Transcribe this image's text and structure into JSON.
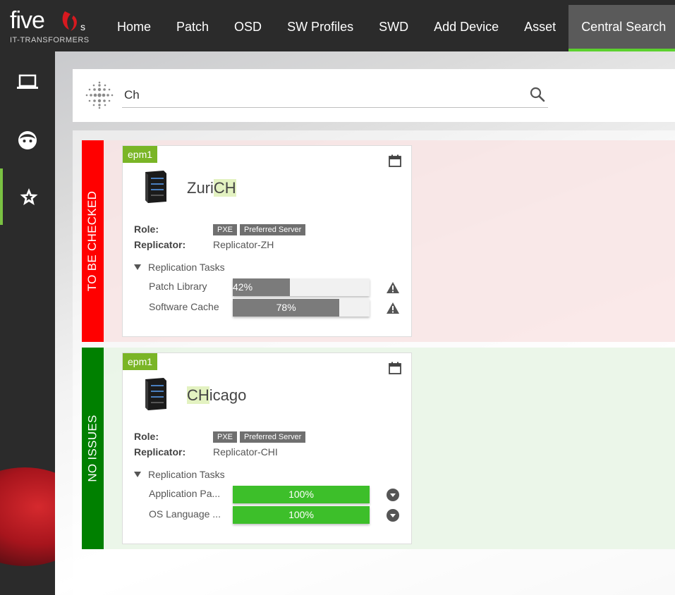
{
  "logo": {
    "word": "five",
    "suffix": "s",
    "subtitle": "IT-TRANSFORMERS"
  },
  "nav": {
    "items": [
      {
        "label": "Home"
      },
      {
        "label": "Patch"
      },
      {
        "label": "OSD"
      },
      {
        "label": "SW Profiles"
      },
      {
        "label": "SWD"
      },
      {
        "label": "Add Device"
      },
      {
        "label": "Asset"
      },
      {
        "label": "Central Search",
        "active": true
      }
    ]
  },
  "sidebar": {
    "items": [
      {
        "icon": "laptop-icon"
      },
      {
        "icon": "face-icon"
      },
      {
        "icon": "star-icon",
        "active": true
      }
    ]
  },
  "search": {
    "value": "Ch",
    "placeholder": ""
  },
  "groups": [
    {
      "label": "TO BE CHECKED",
      "color": "#ff0000",
      "card": {
        "tag": "epm1",
        "name_prefix": "Zuri",
        "name_highlight": "CH",
        "name_suffix": "",
        "role_label": "Role:",
        "roles": [
          "PXE",
          "Preferred Server"
        ],
        "replicator_label": "Replicator:",
        "replicator": "Replicator-ZH",
        "tasks_title": "Replication Tasks",
        "tasks": [
          {
            "name": "Patch Library",
            "progress": 42,
            "progress_text": "42%",
            "status_icon": "warning-icon"
          },
          {
            "name": "Software Cache",
            "progress": 78,
            "progress_text": "78%",
            "status_icon": "warning-icon"
          }
        ]
      }
    },
    {
      "label": "NO ISSUES",
      "color": "#008000",
      "card": {
        "tag": "epm1",
        "name_prefix": "",
        "name_highlight": "CH",
        "name_suffix": "icago",
        "role_label": "Role:",
        "roles": [
          "PXE",
          "Preferred Server"
        ],
        "replicator_label": "Replicator:",
        "replicator": "Replicator-CHI",
        "tasks_title": "Replication Tasks",
        "tasks": [
          {
            "name": "Application Pa...",
            "progress": 100,
            "progress_text": "100%",
            "status_icon": "chevron-down-circle-icon"
          },
          {
            "name": "OS Language ...",
            "progress": 100,
            "progress_text": "100%",
            "status_icon": "chevron-down-circle-icon"
          }
        ]
      }
    }
  ],
  "colors": {
    "accent": "#5cd12e",
    "tag": "#7ab526",
    "progress_ok": "#3dbf2a",
    "progress_pending": "#7b7b7b"
  }
}
